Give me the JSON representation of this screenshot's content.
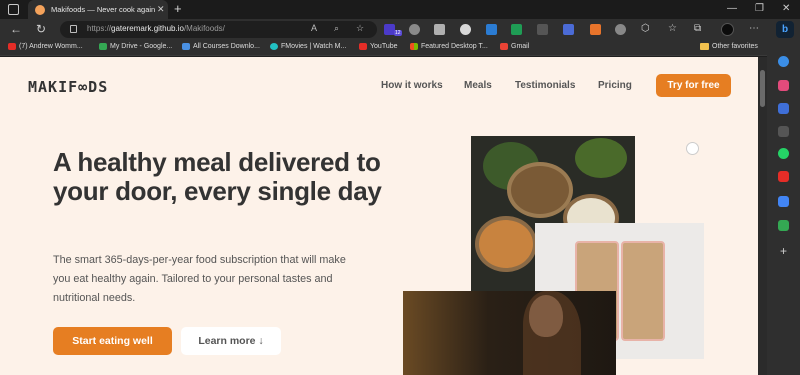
{
  "browser": {
    "tab_title": "Makifoods — Never cook again!",
    "url_prefix": "https://",
    "url_host": "gateremark.github.io",
    "url_path": "/Makifoods/",
    "extension_badge": "12",
    "bookmarks": [
      {
        "label": "(7) Andrew Womm...",
        "color": "#e52d27"
      },
      {
        "label": "My Drive - Google...",
        "color": "#34a853"
      },
      {
        "label": "All Courses Downlo...",
        "color": "#4a90e2"
      },
      {
        "label": "FMovies | Watch M...",
        "color": "#22c1c3"
      },
      {
        "label": "YouTube",
        "color": "#e52d27"
      },
      {
        "label": "Featured Desktop T...",
        "color": "#f25022"
      },
      {
        "label": "Gmail",
        "color": "#ea4335"
      }
    ],
    "other_favorites": "Other favorites"
  },
  "site": {
    "logo": "MAKIF∞DS",
    "nav": {
      "how_it_works": "How it works",
      "meals": "Meals",
      "testimonials": "Testimonials",
      "pricing": "Pricing",
      "cta": "Try for free"
    },
    "hero": {
      "title": "A healthy meal delivered to your door, every single day",
      "text": "The smart 365-days-per-year food subscription that will make you eat healthy again. Tailored to your personal tastes and nutritional needs.",
      "primary_button": "Start eating well",
      "secondary_button": "Learn more ↓"
    }
  },
  "colors": {
    "accent": "#e67e22",
    "page_bg": "#fdf2e9",
    "heading": "#333333"
  }
}
